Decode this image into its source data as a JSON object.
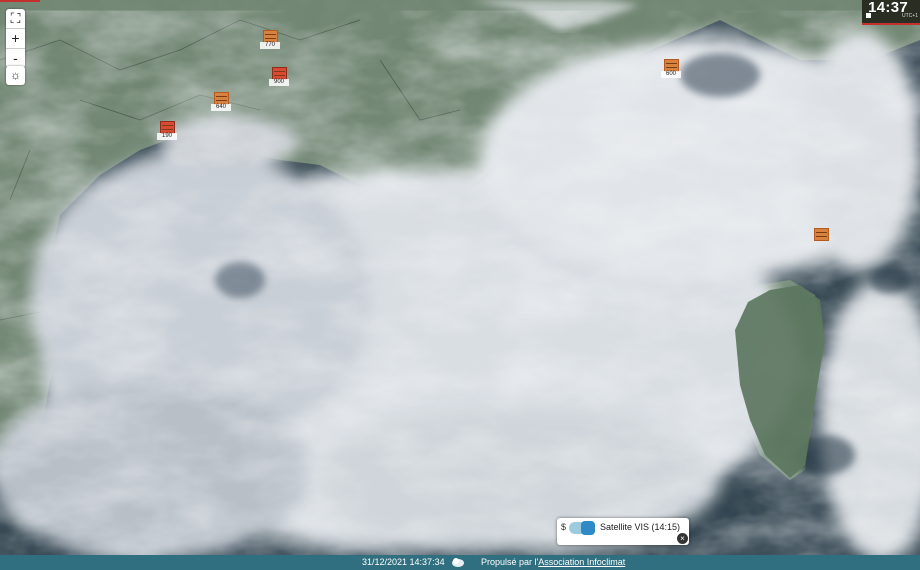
{
  "map": {
    "layer_name": "Satellite VIS (14:15)",
    "stations": [
      {
        "id": "st1",
        "value": "770",
        "color": "orange"
      },
      {
        "id": "st2",
        "value": "900",
        "color": "red"
      },
      {
        "id": "st3",
        "value": "640",
        "color": "orange"
      },
      {
        "id": "st4",
        "value": "190",
        "color": "red"
      },
      {
        "id": "st5",
        "value": "600",
        "color": "orange"
      },
      {
        "id": "st6",
        "value": "",
        "color": "orange"
      }
    ]
  },
  "controls": {
    "zoom_fullscreen_icon": "⛶",
    "zoom_in": "+",
    "zoom_out": "-",
    "settings_icon": "☼"
  },
  "clock": {
    "time": "14:37",
    "tz": "UTC+1"
  },
  "legend": {
    "currency": "$",
    "label": "Satellite VIS (14:15)",
    "close": "×"
  },
  "footer": {
    "timestamp": "31/12/2021 14:37:34",
    "powered_prefix": "Propulsé par l'",
    "powered_link": "Association Infoclimat"
  },
  "colors": {
    "land": "#6f8570",
    "sea": "#283a4a",
    "cloud": "#e2e6ea",
    "footer": "#2f6f7f",
    "accent": "#c4302b"
  }
}
